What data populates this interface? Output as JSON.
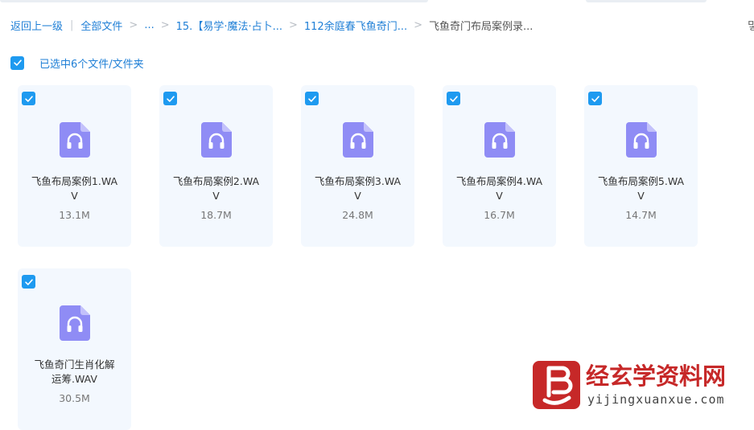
{
  "breadcrumb": {
    "back": "返回上一级",
    "all_files": "全部文件",
    "ellipsis": "...",
    "level1": "15.【易学·魔法·占卜...",
    "level2": "112余庭春飞鱼奇门...",
    "current": "飞鱼奇门布局案例录..."
  },
  "right_glyph": "밓",
  "selection": {
    "text": "已选中6个文件/文件夹"
  },
  "files": [
    {
      "line1": "飞鱼布局案例1.WA",
      "line2": "V",
      "size": "13.1M",
      "selected": true
    },
    {
      "line1": "飞鱼布局案例2.WA",
      "line2": "V",
      "size": "18.7M",
      "selected": true
    },
    {
      "line1": "飞鱼布局案例3.WA",
      "line2": "V",
      "size": "24.8M",
      "selected": true
    },
    {
      "line1": "飞鱼布局案例4.WA",
      "line2": "V",
      "size": "16.7M",
      "selected": true
    },
    {
      "line1": "飞鱼布局案例5.WA",
      "line2": "V",
      "size": "14.7M",
      "selected": true
    },
    {
      "line1": "飞鱼奇门生肖化解",
      "line2": "运筹.WAV",
      "size": "30.5M",
      "selected": true
    }
  ],
  "icons": {
    "file": "audio-file-icon",
    "check": "check-icon"
  },
  "colors": {
    "accent": "#1e9af0",
    "link": "#1f7fd6",
    "card_bg": "#f3f8fe",
    "icon": "#8f8cf5",
    "watermark": "#c62828"
  },
  "watermark": {
    "cn": "经玄学资料网",
    "en": "yijingxuanxue.com"
  }
}
